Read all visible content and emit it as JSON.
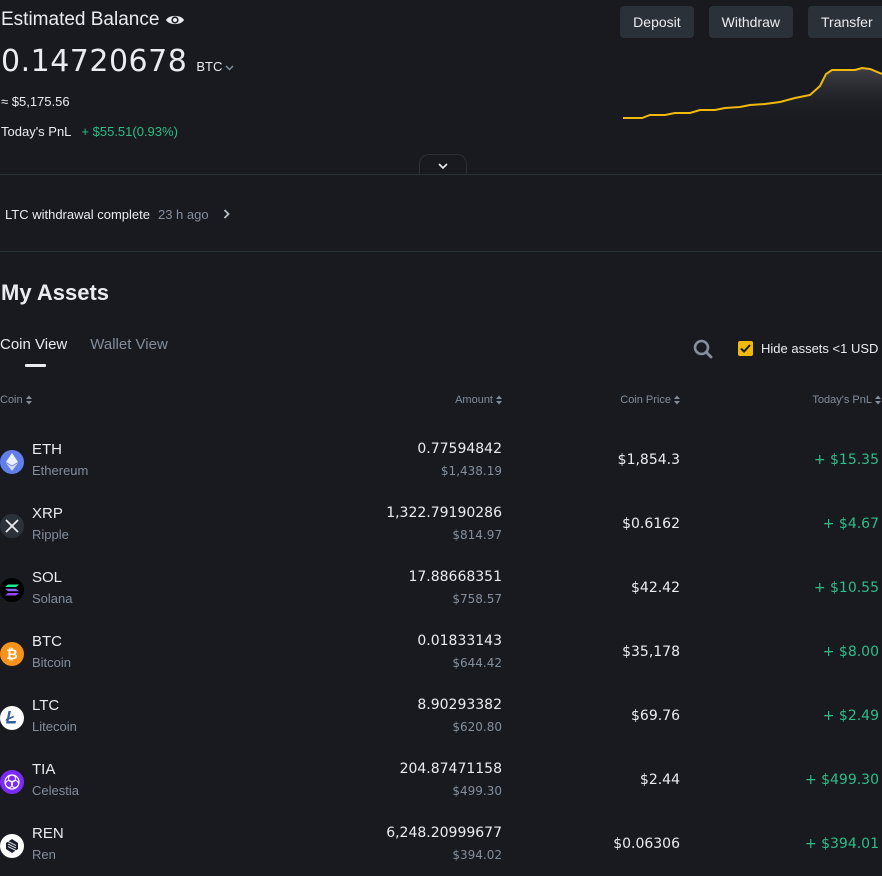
{
  "header": {
    "title": "Estimated Balance",
    "balance": "0.14720678",
    "unit": "BTC",
    "usd_value": "≈ $5,175.56",
    "pnl_label": "Today's PnL",
    "pnl_value": "+ $55.51(0.93%)"
  },
  "actions": {
    "deposit": "Deposit",
    "withdraw": "Withdraw",
    "transfer": "Transfer"
  },
  "notice": {
    "text": "LTC withdrawal complete",
    "time": "23 h ago"
  },
  "assets": {
    "title": "My Assets",
    "tabs": [
      "Coin View",
      "Wallet View"
    ],
    "hide_small_label": "Hide assets <1 USD",
    "hide_small_checked": true,
    "columns": {
      "coin": "Coin",
      "amount": "Amount",
      "price": "Coin Price",
      "pnl": "Today's PnL"
    },
    "rows": [
      {
        "symbol": "ETH",
        "name": "Ethereum",
        "amount": "0.77594842",
        "amount_usd": "$1,438.19",
        "price": "$1,854.3",
        "pnl": "+ $15.35",
        "icon": "eth-icon",
        "color": "#627eea"
      },
      {
        "symbol": "XRP",
        "name": "Ripple",
        "amount": "1,322.79190286",
        "amount_usd": "$814.97",
        "price": "$0.6162",
        "pnl": "+ $4.67",
        "icon": "xrp-icon",
        "color": "#2b3139"
      },
      {
        "symbol": "SOL",
        "name": "Solana",
        "amount": "17.88668351",
        "amount_usd": "$758.57",
        "price": "$42.42",
        "pnl": "+ $10.55",
        "icon": "sol-icon",
        "color": "#000000"
      },
      {
        "symbol": "BTC",
        "name": "Bitcoin",
        "amount": "0.01833143",
        "amount_usd": "$644.42",
        "price": "$35,178",
        "pnl": "+ $8.00",
        "icon": "btc-icon",
        "color": "#f7931a"
      },
      {
        "symbol": "LTC",
        "name": "Litecoin",
        "amount": "8.90293382",
        "amount_usd": "$620.80",
        "price": "$69.76",
        "pnl": "+ $2.49",
        "icon": "ltc-icon",
        "color": "#ffffff"
      },
      {
        "symbol": "TIA",
        "name": "Celestia",
        "amount": "204.87471158",
        "amount_usd": "$499.30",
        "price": "$2.44",
        "pnl": "+ $499.30",
        "icon": "tia-icon",
        "color": "#7b2bf9"
      },
      {
        "symbol": "REN",
        "name": "Ren",
        "amount": "6,248.20999677",
        "amount_usd": "$394.02",
        "price": "$0.06306",
        "pnl": "+ $394.01",
        "icon": "ren-icon",
        "color": "#ffffff"
      }
    ]
  },
  "colors": {
    "background": "#181a20",
    "positive": "#2ebd85",
    "accent": "#f0b90b",
    "muted": "#848e9c"
  }
}
